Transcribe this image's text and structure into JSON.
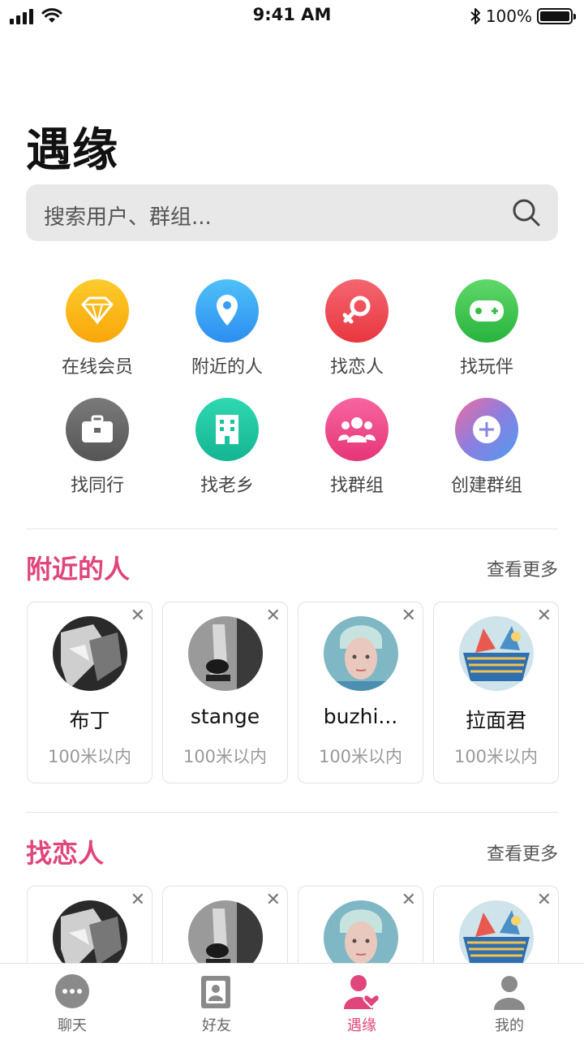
{
  "status_bar": {
    "time": "9:41 AM",
    "battery": "100%"
  },
  "title": "遇缘",
  "search": {
    "placeholder": "搜索用户、群组..."
  },
  "categories": [
    {
      "label": "在线会员",
      "icon": "diamond-icon",
      "color": "#fbb40f"
    },
    {
      "label": "附近的人",
      "icon": "location-pin-icon",
      "color": "#3fa6f2"
    },
    {
      "label": "找恋人",
      "icon": "female-symbol-icon",
      "color": "#f04e55"
    },
    {
      "label": "找玩伴",
      "icon": "gamepad-icon",
      "color": "#3dc54f"
    },
    {
      "label": "找同行",
      "icon": "briefcase-icon",
      "color": "#6b6b6b"
    },
    {
      "label": "找老乡",
      "icon": "building-icon",
      "color": "#1ec9a3"
    },
    {
      "label": "找群组",
      "icon": "group-icon",
      "color": "#f04a8a"
    },
    {
      "label": "创建群组",
      "icon": "plus-icon",
      "color": "#9a7fd6"
    }
  ],
  "sections": {
    "nearby": {
      "title": "附近的人",
      "more": "查看更多",
      "cards": [
        {
          "name": "布丁",
          "distance": "100米以内"
        },
        {
          "name": "stange",
          "distance": "100米以内"
        },
        {
          "name": "buzhi...",
          "distance": "100米以内"
        },
        {
          "name": "拉面君",
          "distance": "100米以内"
        }
      ]
    },
    "lover": {
      "title": "找恋人",
      "more": "查看更多"
    }
  },
  "close_glyph": "✕",
  "tabs": [
    {
      "label": "聊天",
      "icon": "chat-icon"
    },
    {
      "label": "好友",
      "icon": "contacts-icon"
    },
    {
      "label": "遇缘",
      "icon": "match-heart-icon",
      "active": true
    },
    {
      "label": "我的",
      "icon": "profile-icon"
    }
  ],
  "colors": {
    "accent": "#e0457b",
    "search_bg": "#e8e8e8"
  }
}
